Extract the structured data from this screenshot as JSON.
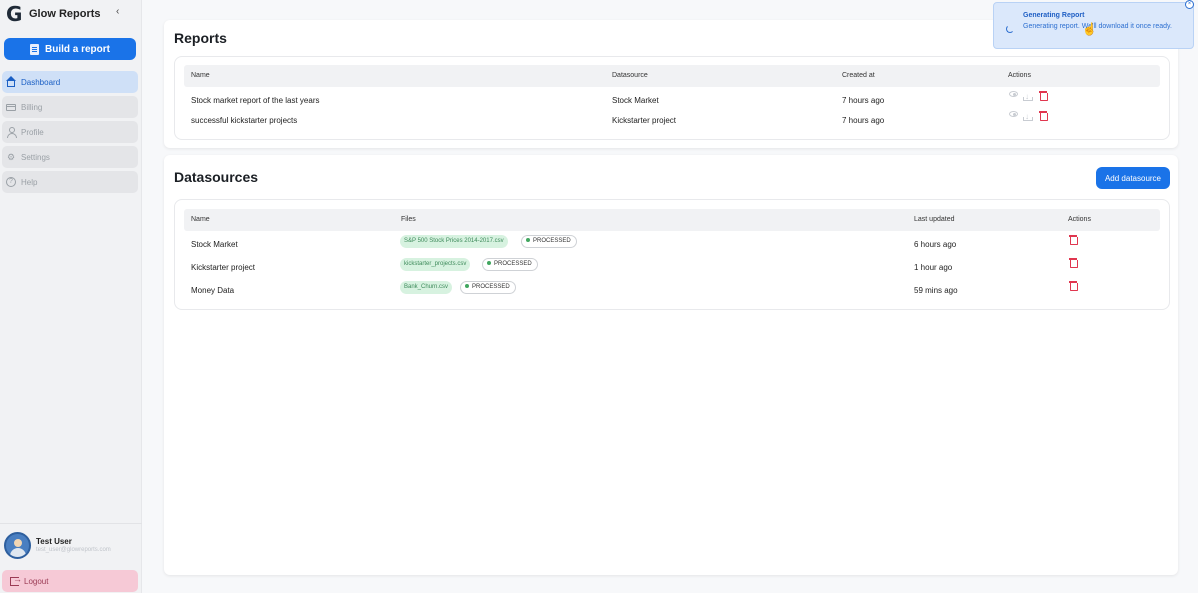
{
  "app": {
    "name": "Glow Reports",
    "collapse_icon": "chevron-left-icon"
  },
  "sidebar": {
    "build_button": "Build a report",
    "items": [
      {
        "label": "Dashboard",
        "icon": "home-icon",
        "active": true
      },
      {
        "label": "Billing",
        "icon": "credit-card-icon",
        "active": false
      },
      {
        "label": "Profile",
        "icon": "user-icon",
        "active": false
      },
      {
        "label": "Settings",
        "icon": "gear-icon",
        "active": false
      },
      {
        "label": "Help",
        "icon": "help-icon",
        "active": false
      }
    ],
    "user": {
      "name": "Test User",
      "email": "test_user@glowreports.com"
    },
    "logout": "Logout"
  },
  "reports": {
    "title": "Reports",
    "columns": {
      "name": "Name",
      "datasource": "Datasource",
      "created": "Created at",
      "actions": "Actions"
    },
    "rows": [
      {
        "name": "Stock market report of the last years",
        "datasource": "Stock Market",
        "created": "7 hours ago"
      },
      {
        "name": "successful kickstarter projects",
        "datasource": "Kickstarter project",
        "created": "7 hours ago"
      }
    ]
  },
  "datasources": {
    "title": "Datasources",
    "add_button": "Add datasource",
    "columns": {
      "name": "Name",
      "files": "Files",
      "updated": "Last updated",
      "actions": "Actions"
    },
    "rows": [
      {
        "name": "Stock Market",
        "file": "S&P 500 Stock Prices 2014-2017.csv",
        "status": "PROCESSED",
        "updated": "6 hours ago"
      },
      {
        "name": "Kickstarter project",
        "file": "kickstarter_projects.csv",
        "status": "PROCESSED",
        "updated": "1 hour ago"
      },
      {
        "name": "Money Data",
        "file": "Bank_Churn.csv",
        "status": "PROCESSED",
        "updated": "59 mins ago"
      }
    ]
  },
  "toast": {
    "title": "Generating Report",
    "message": "Generating report. We'll download it once ready."
  },
  "colors": {
    "primary": "#1a73e8",
    "danger": "#e0364f",
    "success": "#41a65f",
    "logout_bg": "#f6c9d6"
  }
}
